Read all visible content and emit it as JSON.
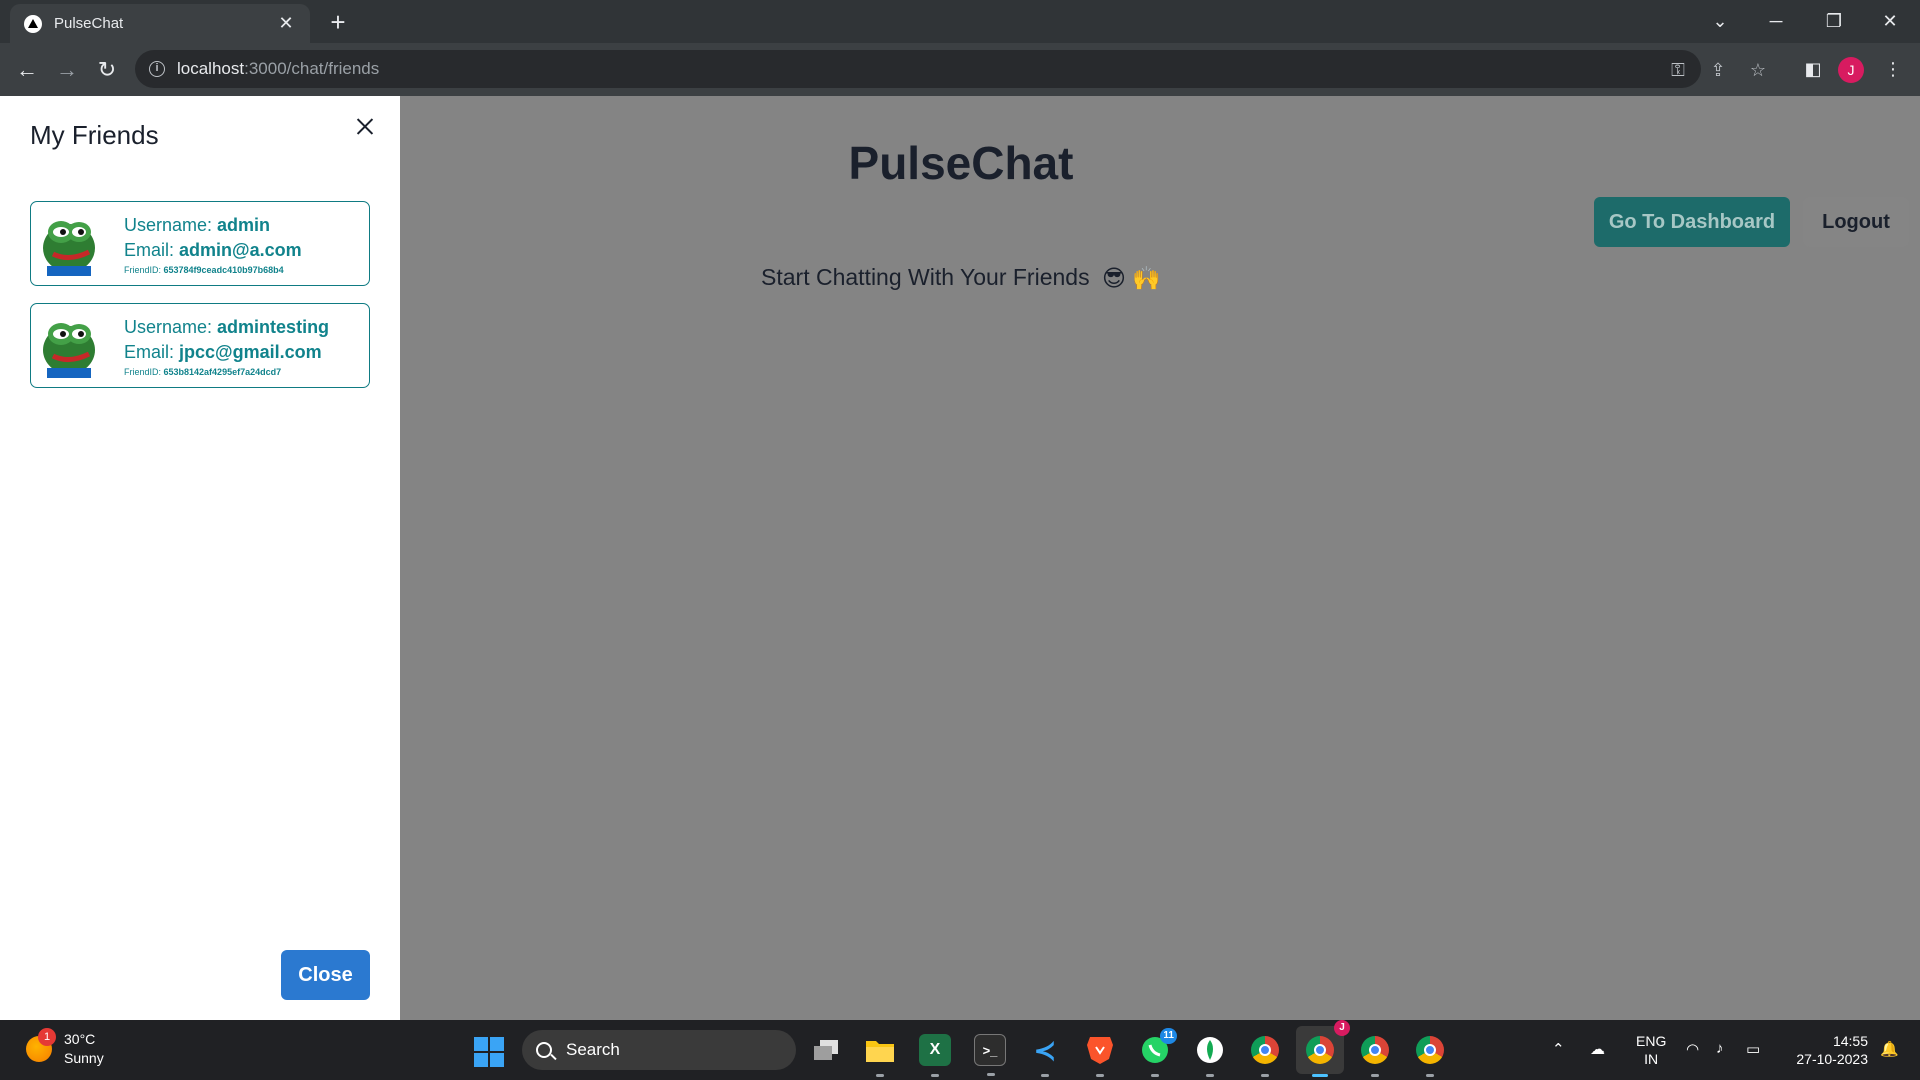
{
  "browser": {
    "tab_title": "PulseChat",
    "tab_close": "✕",
    "new_tab": "+",
    "url_host": "localhost",
    "url_path": ":3000/chat/friends",
    "profile_initial": "J"
  },
  "drawer": {
    "title": "My Friends",
    "close_label": "Close",
    "friends": [
      {
        "username_label": "Username: ",
        "username": "admin",
        "email_label": "Email: ",
        "email": "admin@a.com",
        "id_label": "FriendID: ",
        "id": "653784f9ceadc410b97b68b4"
      },
      {
        "username_label": "Username: ",
        "username": "admintesting",
        "email_label": "Email: ",
        "email": "jpcc@gmail.com",
        "id_label": "FriendID: ",
        "id": "653b8142af4295ef7a24dcd7"
      }
    ]
  },
  "main": {
    "title": "PulseChat",
    "subtitle": "Start Chatting With Your Friends",
    "subtitle_emojis": "😎 🙌",
    "dashboard_button": "Go To Dashboard",
    "logout_button": "Logout"
  },
  "taskbar": {
    "weather_temp": "30°C",
    "weather_desc": "Sunny",
    "weather_badge": "1",
    "search_label": "Search",
    "whatsapp_badge": "11",
    "chrome_profile_badge": "J",
    "lang_top": "ENG",
    "lang_bottom": "IN",
    "time": "14:55",
    "date": "27-10-2023"
  },
  "colors": {
    "accent_teal": "#11838c",
    "dashboard_button": "#1d6b6a",
    "close_button": "#2b79d0",
    "overlay": "#848484"
  }
}
